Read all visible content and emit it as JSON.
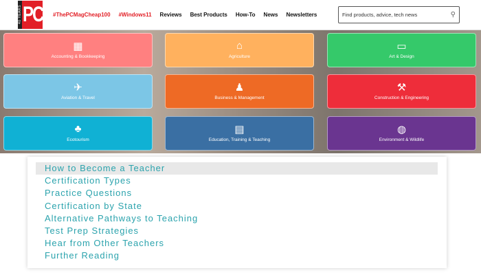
{
  "header": {
    "logo_text": "PC",
    "logo_years": "40 YEARS",
    "nav": [
      "#ThePCMagCheap100",
      "#Windows11",
      "Reviews",
      "Best Products",
      "How-To",
      "News",
      "Newsletters"
    ],
    "search_placeholder": "Find products, advice, tech news"
  },
  "tiles": [
    {
      "label": "Accounting & Bookkeeping",
      "icon": "calculator-icon",
      "glyph": "▦",
      "color": "#ff8080"
    },
    {
      "label": "Agriculture",
      "icon": "barn-icon",
      "glyph": "⌂",
      "color": "#ffb15e"
    },
    {
      "label": "Art & Design",
      "icon": "monitor-icon",
      "glyph": "▭",
      "color": "#35c96a"
    },
    {
      "label": "Aviation & Travel",
      "icon": "airplane-icon",
      "glyph": "✈",
      "color": "#7cc6e6"
    },
    {
      "label": "Business & Management",
      "icon": "org-chart-icon",
      "glyph": "♟",
      "color": "#ee6a25"
    },
    {
      "label": "Construction & Engineering",
      "icon": "wrench-icon",
      "glyph": "⚒",
      "color": "#ee2d3a"
    },
    {
      "label": "Ecotourism",
      "icon": "trees-icon",
      "glyph": "♣",
      "color": "#10b1d4"
    },
    {
      "label": "Education, Training & Teaching",
      "icon": "teacher-icon",
      "glyph": "▤",
      "color": "#3a6fa3"
    },
    {
      "label": "Environment & Wildlife",
      "icon": "globe-icon",
      "glyph": "◍",
      "color": "#6a3590"
    }
  ],
  "menu": [
    "How to Become a Teacher",
    "Certification Types",
    "Practice Questions",
    "Certification by State",
    "Alternative Pathways to Teaching",
    "Test Prep Strategies",
    "Hear from Other Teachers",
    "Further Reading"
  ]
}
